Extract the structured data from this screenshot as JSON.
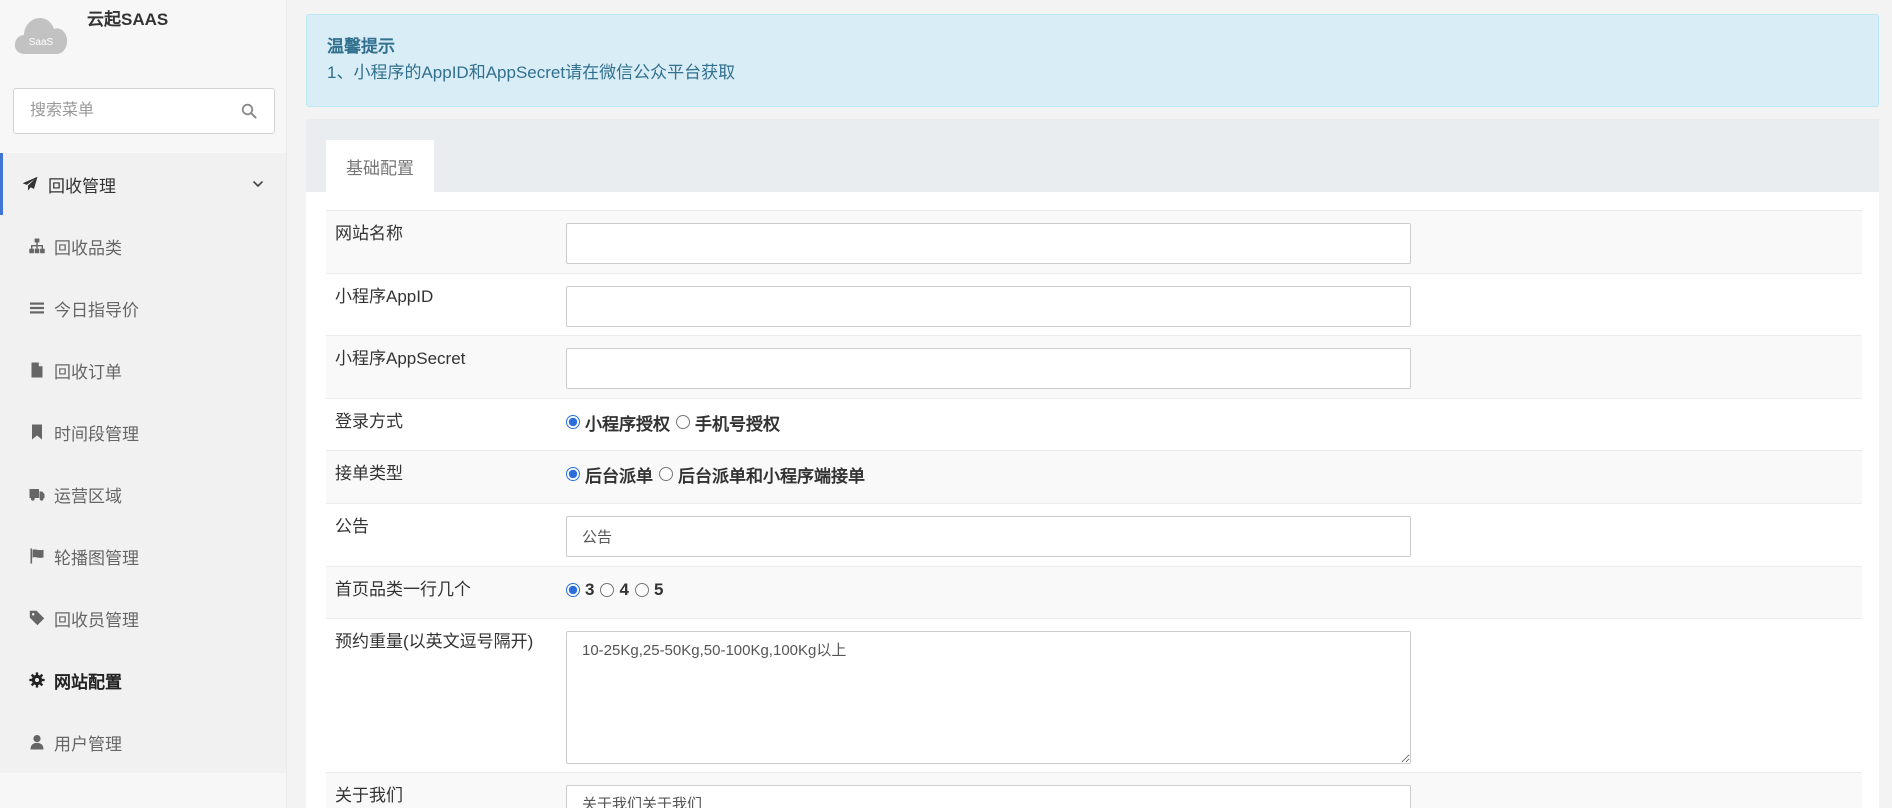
{
  "sidebar": {
    "logo_text": "SaaS",
    "brand": "云起SAAS",
    "search_placeholder": "搜索菜单",
    "menu": [
      {
        "label": "回收管理",
        "icon": "paper-plane-icon",
        "expanded": true
      },
      {
        "label": "回收品类",
        "icon": "sitemap-icon"
      },
      {
        "label": "今日指导价",
        "icon": "bars-icon"
      },
      {
        "label": "回收订单",
        "icon": "file-icon"
      },
      {
        "label": "时间段管理",
        "icon": "bookmark-icon"
      },
      {
        "label": "运营区域",
        "icon": "truck-icon"
      },
      {
        "label": "轮播图管理",
        "icon": "flag-icon"
      },
      {
        "label": "回收员管理",
        "icon": "tag-icon"
      },
      {
        "label": "网站配置",
        "icon": "gear-icon",
        "active": true
      },
      {
        "label": "用户管理",
        "icon": "user-icon"
      }
    ]
  },
  "alert": {
    "title": "温馨提示",
    "text": "1、小程序的AppID和AppSecret请在微信公众平台获取"
  },
  "tabs": [
    {
      "label": "基础配置",
      "active": true
    }
  ],
  "form": {
    "site_name": {
      "label": "网站名称",
      "value": ""
    },
    "app_id": {
      "label": "小程序AppID",
      "value": ""
    },
    "app_secret": {
      "label": "小程序AppSecret",
      "value": ""
    },
    "login_method": {
      "label": "登录方式",
      "options": [
        "小程序授权",
        "手机号授权"
      ],
      "selected": "小程序授权"
    },
    "order_type": {
      "label": "接单类型",
      "options": [
        "后台派单",
        "后台派单和小程序端接单"
      ],
      "selected": "后台派单"
    },
    "notice": {
      "label": "公告",
      "value": "公告"
    },
    "category_per_row": {
      "label": "首页品类一行几个",
      "options": [
        "3",
        "4",
        "5"
      ],
      "selected": "3"
    },
    "reserve_weight": {
      "label": "预约重量(以英文逗号隔开)",
      "value": "10-25Kg,25-50Kg,50-100Kg,100Kg以上"
    },
    "about_us": {
      "label": "关于我们",
      "value": "关于我们关于我们"
    }
  },
  "colors": {
    "accent": "#3f76d6",
    "alert_background": "#d9edf7",
    "alert_text": "#31708f"
  }
}
